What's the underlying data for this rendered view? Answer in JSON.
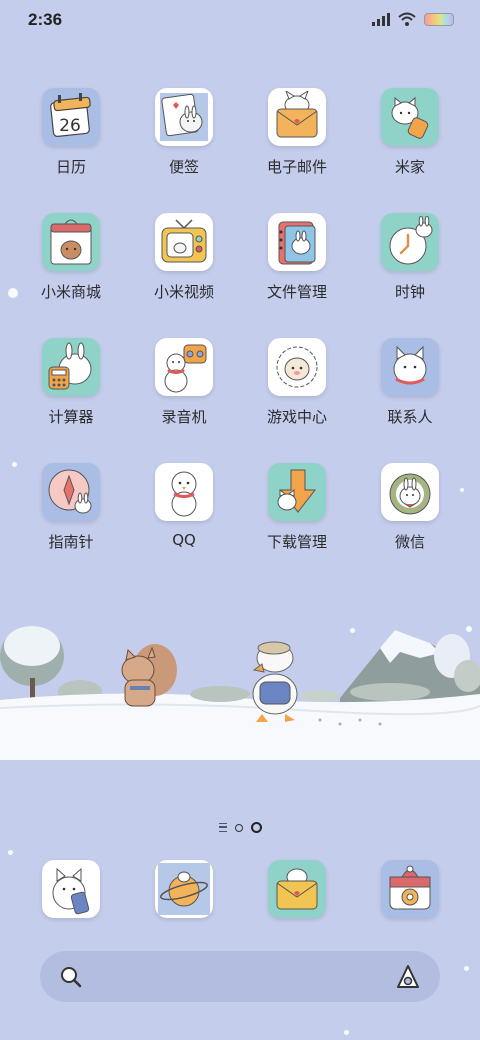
{
  "status_bar": {
    "time": "2:36"
  },
  "apps": [
    {
      "label": "日历",
      "icon": "calendar-icon",
      "calendar_day": "26"
    },
    {
      "label": "便签",
      "icon": "notes-icon"
    },
    {
      "label": "电子邮件",
      "icon": "mail-icon"
    },
    {
      "label": "米家",
      "icon": "mijia-icon"
    },
    {
      "label": "小米商城",
      "icon": "mi-store-icon"
    },
    {
      "label": "小米视频",
      "icon": "mi-video-icon"
    },
    {
      "label": "文件管理",
      "icon": "file-manager-icon"
    },
    {
      "label": "时钟",
      "icon": "clock-icon"
    },
    {
      "label": "计算器",
      "icon": "calculator-icon"
    },
    {
      "label": "录音机",
      "icon": "recorder-icon"
    },
    {
      "label": "游戏中心",
      "icon": "game-center-icon"
    },
    {
      "label": "联系人",
      "icon": "contacts-icon"
    },
    {
      "label": "指南针",
      "icon": "compass-icon"
    },
    {
      "label": "QQ",
      "icon": "qq-icon"
    },
    {
      "label": "下载管理",
      "icon": "download-manager-icon"
    },
    {
      "label": "微信",
      "icon": "wechat-icon"
    }
  ],
  "page_indicator": {
    "total_pages": 2,
    "active_page": 2
  },
  "dock": [
    {
      "icon": "phone-icon"
    },
    {
      "icon": "browser-icon"
    },
    {
      "icon": "messages-icon"
    },
    {
      "icon": "camera-icon"
    }
  ],
  "colors": {
    "background": "#c4cdec",
    "search_bar": "#b3bde0",
    "snow": "#ffffff"
  }
}
